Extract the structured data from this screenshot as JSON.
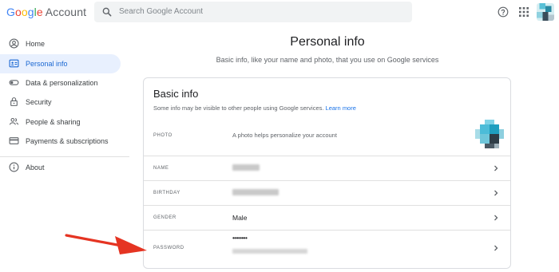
{
  "header": {
    "logo_google": "Google",
    "logo_account": "Account",
    "search_placeholder": "Search Google Account"
  },
  "sidebar": {
    "items": [
      {
        "label": "Home",
        "icon": "person-circle-icon",
        "active": false
      },
      {
        "label": "Personal info",
        "icon": "id-card-icon",
        "active": true
      },
      {
        "label": "Data & personalization",
        "icon": "toggle-icon",
        "active": false
      },
      {
        "label": "Security",
        "icon": "lock-icon",
        "active": false
      },
      {
        "label": "People & sharing",
        "icon": "people-icon",
        "active": false
      },
      {
        "label": "Payments & subscriptions",
        "icon": "credit-card-icon",
        "active": false
      },
      {
        "label": "About",
        "icon": "info-icon",
        "active": false
      }
    ]
  },
  "main": {
    "title": "Personal info",
    "subtitle": "Basic info, like your name and photo, that you use on Google services",
    "card": {
      "title": "Basic info",
      "description": "Some info may be visible to other people using Google services.",
      "learn_more": "Learn more",
      "rows": {
        "photo": {
          "label": "PHOTO",
          "hint": "A photo helps personalize your account"
        },
        "name": {
          "label": "NAME"
        },
        "birthday": {
          "label": "BIRTHDAY"
        },
        "gender": {
          "label": "GENDER",
          "value": "Male"
        },
        "password": {
          "label": "PASSWORD",
          "value": "••••••••"
        }
      }
    }
  },
  "colors": {
    "accent": "#1967d2",
    "active_bg": "#e8f0fe",
    "arrow": "#e53422"
  }
}
